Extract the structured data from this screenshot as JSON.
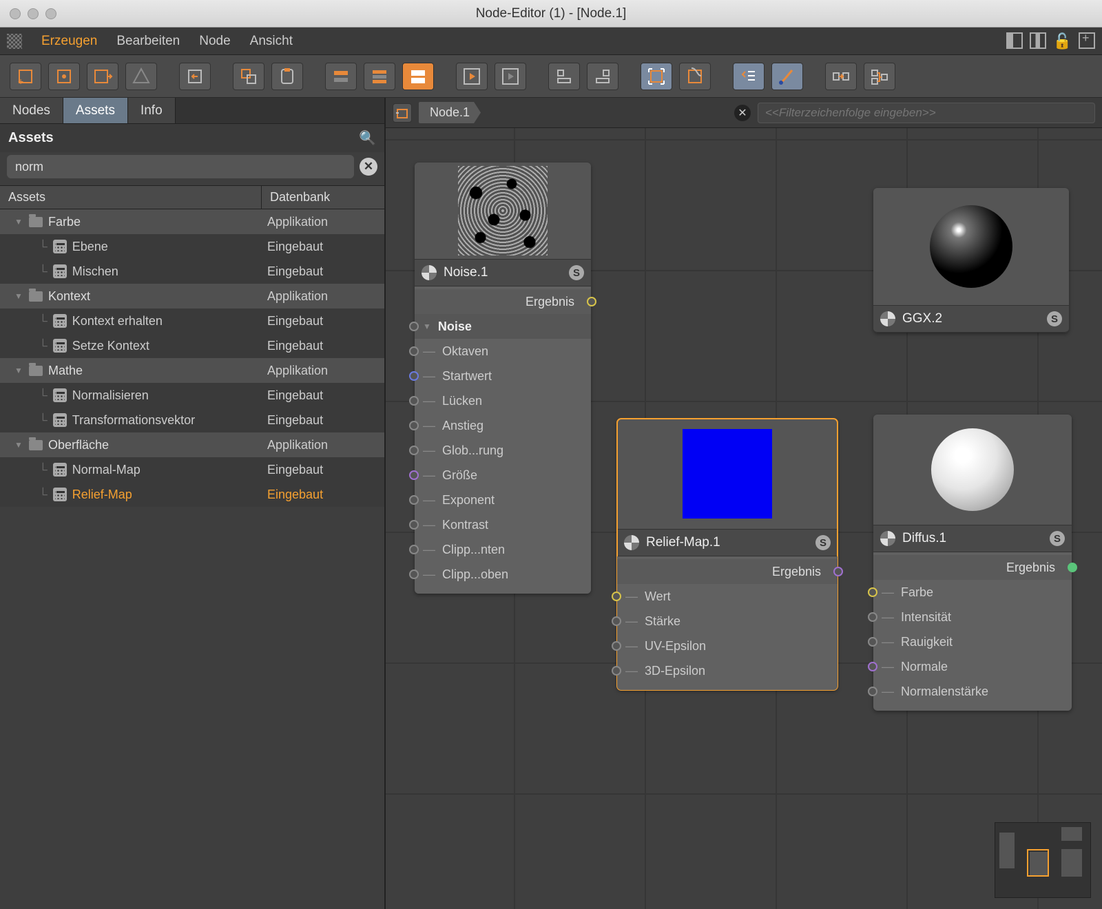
{
  "window": {
    "title": "Node-Editor (1) - [Node.1]"
  },
  "menu": {
    "items": [
      "Erzeugen",
      "Bearbeiten",
      "Node",
      "Ansicht"
    ],
    "active_index": 0
  },
  "left_tabs": {
    "items": [
      "Nodes",
      "Assets",
      "Info"
    ],
    "active_index": 1
  },
  "assets": {
    "title": "Assets",
    "search_value": "norm",
    "columns": {
      "name": "Assets",
      "db": "Datenbank"
    },
    "db_app": "Applikation",
    "db_builtin": "Eingebaut",
    "tree": [
      {
        "type": "cat",
        "label": "Farbe",
        "db": "Applikation"
      },
      {
        "type": "item",
        "label": "Ebene",
        "db": "Eingebaut"
      },
      {
        "type": "item",
        "label": "Mischen",
        "db": "Eingebaut"
      },
      {
        "type": "cat",
        "label": "Kontext",
        "db": "Applikation"
      },
      {
        "type": "item",
        "label": "Kontext erhalten",
        "db": "Eingebaut"
      },
      {
        "type": "item",
        "label": "Setze Kontext",
        "db": "Eingebaut"
      },
      {
        "type": "cat",
        "label": "Mathe",
        "db": "Applikation"
      },
      {
        "type": "item",
        "label": "Normalisieren",
        "db": "Eingebaut"
      },
      {
        "type": "item",
        "label": "Transformationsvektor",
        "db": "Eingebaut"
      },
      {
        "type": "cat",
        "label": "Oberfläche",
        "db": "Applikation"
      },
      {
        "type": "item",
        "label": "Normal-Map",
        "db": "Eingebaut"
      },
      {
        "type": "item",
        "label": "Relief-Map",
        "db": "Eingebaut",
        "selected": true
      }
    ]
  },
  "breadcrumb": {
    "path": "Node.1",
    "filter_placeholder": "<<Filterzeichenfolge eingeben>>"
  },
  "nodes": {
    "noise": {
      "title": "Noise.1",
      "output": "Ergebnis",
      "group": "Noise",
      "params": [
        "Oktaven",
        "Startwert",
        "Lücken",
        "Anstieg",
        "Glob...rung",
        "Größe",
        "Exponent",
        "Kontrast",
        "Clipp...nten",
        "Clipp...oben"
      ],
      "param_colors": [
        "grey",
        "blue",
        "grey",
        "grey",
        "grey",
        "purple",
        "grey",
        "grey",
        "grey",
        "grey"
      ]
    },
    "relief": {
      "title": "Relief-Map.1",
      "output": "Ergebnis",
      "params": [
        "Wert",
        "Stärke",
        "UV-Epsilon",
        "3D-Epsilon"
      ],
      "param_colors": [
        "yellow",
        "grey",
        "grey",
        "grey"
      ]
    },
    "ggx": {
      "title": "GGX.2"
    },
    "diffus": {
      "title": "Diffus.1",
      "output": "Ergebnis",
      "params": [
        "Farbe",
        "Intensität",
        "Rauigkeit",
        "Normale",
        "Normalenstärke"
      ],
      "param_colors": [
        "yellow",
        "grey",
        "grey",
        "purple",
        "grey"
      ]
    },
    "s_badge": "S"
  }
}
